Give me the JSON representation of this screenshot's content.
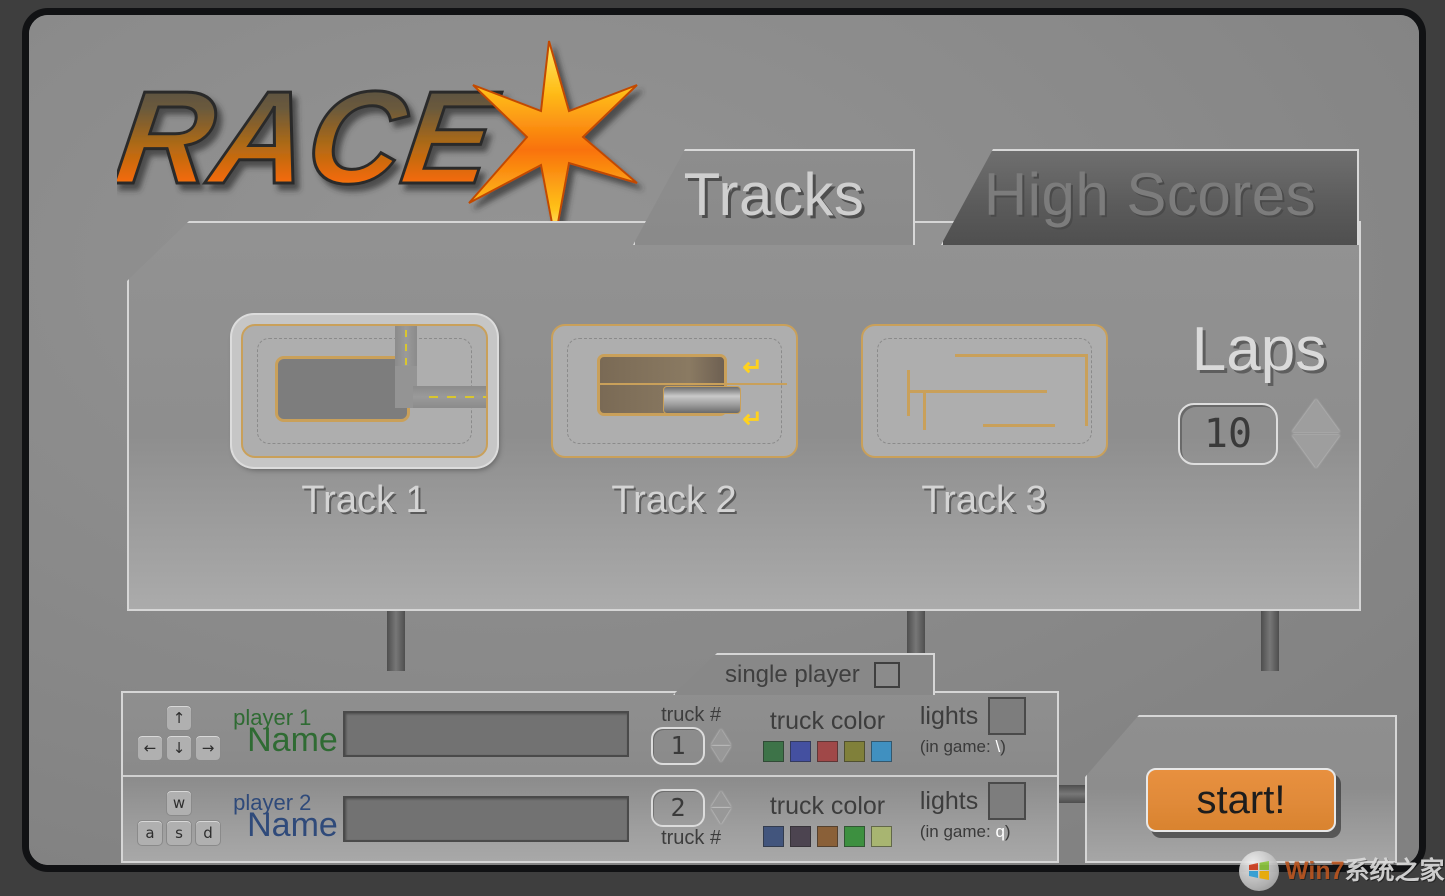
{
  "app": {
    "logo_text": "RACE",
    "logo_mark": "X"
  },
  "tabs": [
    {
      "id": "tracks",
      "label": "Tracks",
      "active": true
    },
    {
      "id": "high-scores",
      "label": "High Scores",
      "active": false
    }
  ],
  "tracks": [
    {
      "id": "track-1",
      "label": "Track 1",
      "selected": true
    },
    {
      "id": "track-2",
      "label": "Track 2",
      "selected": false
    },
    {
      "id": "track-3",
      "label": "Track 3",
      "selected": false
    }
  ],
  "laps": {
    "title": "Laps",
    "value": "10",
    "increase_icon": "triangle-up-icon",
    "decrease_icon": "triangle-down-icon"
  },
  "single_player": {
    "label": "single player",
    "checked": false
  },
  "players": [
    {
      "index": "1",
      "keys": [
        "↑",
        "←",
        "↓",
        "→"
      ],
      "name_small": "player 1",
      "name_big": "Name",
      "name_value": "",
      "name_placeholder": "",
      "truck_hash_label": "truck #",
      "truck_number": "1",
      "truck_color_label": "truck color",
      "truck_colors": [
        "#3d7348",
        "#4450a0",
        "#a04848",
        "#80803a",
        "#4090c0"
      ],
      "lights_label": "lights",
      "lights_checked": false,
      "lights_hint_prefix": "(in game:",
      "lights_hint_key": "\\",
      "lights_hint_suffix": ")",
      "accent_color": "#2f6b33"
    },
    {
      "index": "2",
      "keys": [
        "w",
        "a",
        "s",
        "d"
      ],
      "name_small": "player 2",
      "name_big": "Name",
      "name_value": "",
      "name_placeholder": "",
      "truck_hash_label": "truck #",
      "truck_number": "2",
      "truck_color_label": "truck color",
      "truck_colors": [
        "#42557d",
        "#4c4450",
        "#8a6038",
        "#3d9040",
        "#a8b571"
      ],
      "lights_label": "lights",
      "lights_checked": false,
      "lights_hint_prefix": "(in game:",
      "lights_hint_key": "q",
      "lights_hint_suffix": ")",
      "accent_color": "#2f4a7a"
    }
  ],
  "start": {
    "label": "start!"
  },
  "watermark": {
    "brand": "Win7",
    "brand_cn": "系统之家"
  },
  "colors": {
    "panel": "#8d8d8d",
    "border": "#d6d6d6",
    "track_outline": "#c9a05a",
    "start_orange": "#e08a39"
  }
}
